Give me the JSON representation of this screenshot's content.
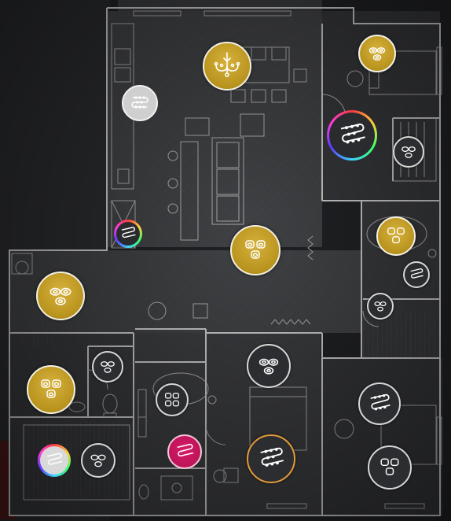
{
  "plan": {
    "colors": {
      "background": "#1a1b1d",
      "floor": "#3c3d40",
      "lines": "#c9c9c9",
      "gold": "#c29e25",
      "dark": "#2c2d30",
      "pink": "#c8155d"
    }
  },
  "controls": [
    {
      "id": "chandelier-dining",
      "type": "chandelier",
      "style": "gold",
      "state": "on"
    },
    {
      "id": "spots-bedroom-ne",
      "type": "spots",
      "style": "gold",
      "state": "on"
    },
    {
      "id": "strip-kitchen",
      "type": "strip",
      "style": "grey",
      "state": "off"
    },
    {
      "id": "strip-corridor-ne",
      "type": "strip",
      "style": "rainbow",
      "state": "rgb"
    },
    {
      "id": "spots-dressing-ne",
      "type": "spots",
      "style": "dark",
      "state": "off"
    },
    {
      "id": "strip-hall-small",
      "type": "strip",
      "style": "rainbow",
      "state": "rgb"
    },
    {
      "id": "spots-living",
      "type": "spots",
      "style": "gold",
      "state": "on"
    },
    {
      "id": "spots-bath-e",
      "type": "spots",
      "style": "gold",
      "state": "on"
    },
    {
      "id": "strip-bath-e",
      "type": "strip",
      "style": "dark",
      "state": "off"
    },
    {
      "id": "spots-hall-w",
      "type": "spots",
      "style": "gold",
      "state": "on"
    },
    {
      "id": "spots-closet-e",
      "type": "spots",
      "style": "dark",
      "state": "off"
    },
    {
      "id": "spots-wc",
      "type": "spots",
      "style": "dark",
      "state": "off"
    },
    {
      "id": "spots-bath-center",
      "type": "spots",
      "style": "dark",
      "state": "off"
    },
    {
      "id": "spots-bedroom-center",
      "type": "spots",
      "style": "dark",
      "state": "off"
    },
    {
      "id": "spots-entry-w",
      "type": "spots",
      "style": "gold",
      "state": "on"
    },
    {
      "id": "strip-bedroom-se",
      "type": "strip",
      "style": "dark",
      "state": "off"
    },
    {
      "id": "strip-bath-pink",
      "type": "strip",
      "style": "pink",
      "state": "on"
    },
    {
      "id": "strip-bedroom-center",
      "type": "strip",
      "style": "dark-orange",
      "state": "off"
    },
    {
      "id": "strip-laundry",
      "type": "strip",
      "style": "rainbow-light",
      "state": "rgb"
    },
    {
      "id": "spots-laundry",
      "type": "spots",
      "style": "dark",
      "state": "off"
    },
    {
      "id": "spots-bedroom-se",
      "type": "spots",
      "style": "dark",
      "state": "off"
    }
  ]
}
